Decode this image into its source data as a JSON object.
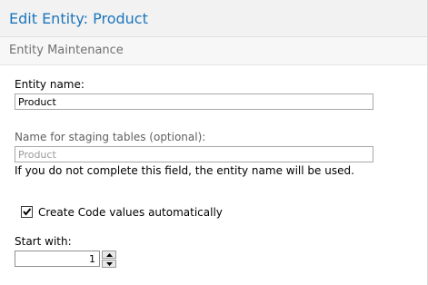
{
  "header": {
    "title": "Edit Entity: Product",
    "subtitle": "Entity Maintenance"
  },
  "form": {
    "entity_name": {
      "label": "Entity name:",
      "value": "Product"
    },
    "staging_name": {
      "label": "Name for staging tables (optional):",
      "placeholder": "Product",
      "help": "If you do not complete this field, the entity name will be used."
    },
    "create_code": {
      "label": "Create Code values automatically",
      "checked": true
    },
    "start_with": {
      "label": "Start with:",
      "value": "1"
    }
  },
  "icons": {
    "check": "check-icon",
    "up": "spin-up-icon",
    "down": "spin-down-icon"
  }
}
